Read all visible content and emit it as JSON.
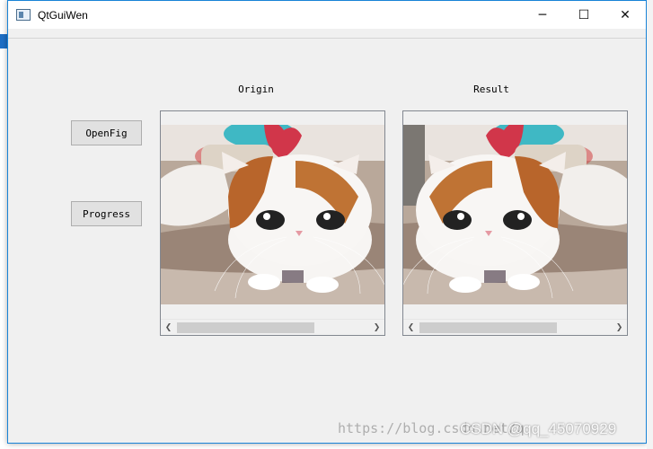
{
  "window": {
    "title": "QtGuiWen",
    "controls": {
      "minimize": "─",
      "maximize": "☐",
      "close": "✕"
    }
  },
  "labels": {
    "origin": "Origin",
    "result": "Result"
  },
  "buttons": {
    "open": "OpenFig",
    "progress": "Progress"
  },
  "scrollbar": {
    "left_arrow": "❮",
    "right_arrow": "❯"
  },
  "image_views": {
    "origin": {
      "content": "cat-photo",
      "flipped": false,
      "scroll_thumb_fraction": 0.72
    },
    "result": {
      "content": "cat-photo",
      "flipped": true,
      "scroll_thumb_fraction": 0.72
    }
  },
  "watermark": {
    "url": "https://blog.csdn.net/q",
    "brand": "CSDN @qq_45070929"
  },
  "colors": {
    "accent": "#1883d7",
    "window_bg": "#f0f0f0",
    "button_bg": "#e1e1e1"
  }
}
